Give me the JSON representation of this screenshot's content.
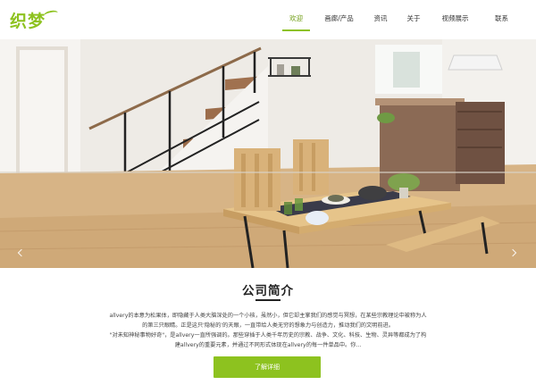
{
  "brand": {
    "logo_text": "织梦",
    "accent_color": "#8dc21f"
  },
  "nav": {
    "items": [
      {
        "label": "欢迎",
        "active": true
      },
      {
        "label": "画廊/产品",
        "active": false
      },
      {
        "label": "资讯",
        "active": false
      },
      {
        "label": "关于",
        "active": false
      },
      {
        "label": "视频展示",
        "active": false
      },
      {
        "label": "联系",
        "active": false
      }
    ]
  },
  "banner": {
    "prev_icon": "chevron-left-icon",
    "next_icon": "chevron-right-icon"
  },
  "about": {
    "title": "公司简介",
    "paragraph_lines": [
      "allvery的本意为松果体，即隐藏于人类大脑深处的一个小核，虽然小，但它却主掌我们的感觉与冥想，在某些宗教理论中被称为人",
      "的第三只眼睛。正是这只'隐秘的'的天眼，一直带给人类无穷的想象力与创造力，推动我们的文明前进。",
      "\"对未知神秘事物好奇\"，是allvery一直所强调的。那些穿插于人类千年历史的宗教、战争、文化、科技、生物、灵异等都成为了构",
      "建allvery的重要元素，并通过不同形式体现在allvery的每一件单品中。你..."
    ],
    "button_label": "了解详细"
  }
}
